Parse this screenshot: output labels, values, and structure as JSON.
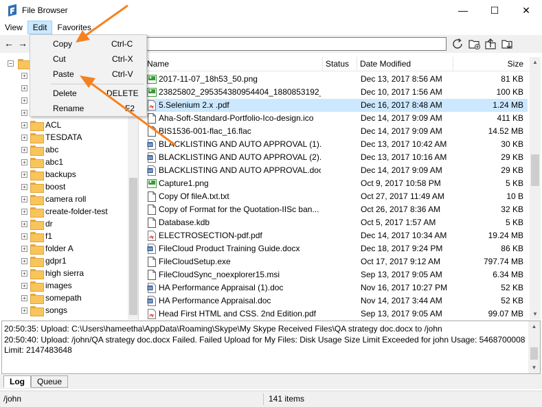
{
  "window": {
    "title": "File Browser",
    "controls": {
      "minimize": "—",
      "maximize": "☐",
      "close": "✕"
    }
  },
  "menubar": {
    "items": [
      "View",
      "Edit",
      "Favorites"
    ],
    "active": "Edit"
  },
  "toolbar": {
    "back": "←",
    "forward": "→",
    "path": ""
  },
  "edit_menu": {
    "items": [
      {
        "label": "Copy",
        "shortcut": "Ctrl-C"
      },
      {
        "label": "Cut",
        "shortcut": "Ctrl-X"
      },
      {
        "label": "Paste",
        "shortcut": "Ctrl-V"
      },
      {
        "label": "Delete",
        "shortcut": "DELETE"
      },
      {
        "label": "Rename",
        "shortcut": "F2"
      }
    ]
  },
  "tree": {
    "folders": [
      "ACL",
      "TESDATA",
      "abc",
      "abc1",
      "backups",
      "boost",
      "camera roll",
      "create-folder-test",
      "dr",
      "f1",
      "folder A",
      "gdpr1",
      "high sierra",
      "images",
      "somepath",
      "songs"
    ],
    "expander": "+"
  },
  "file_list": {
    "columns": {
      "name": "Name",
      "status": "Status",
      "modified": "Date Modified",
      "size": "Size"
    },
    "rows": [
      {
        "name": "2017-11-07_18h53_50.png",
        "status": "",
        "modified": "Dec 13, 2017 8:56 AM",
        "size": "81 KB",
        "type": "image"
      },
      {
        "name": "23825802_295354380954404_1880853192_o....",
        "status": "",
        "modified": "Dec 10, 2017 1:56 AM",
        "size": "100 KB",
        "type": "image"
      },
      {
        "name": "5.Selenium 2.x .pdf",
        "status": "",
        "modified": "Dec 16, 2017 8:48 AM",
        "size": "1.24 MB",
        "type": "pdf"
      },
      {
        "name": "Aha-Soft-Standard-Portfolio-Ico-design.ico",
        "status": "",
        "modified": "Dec 14, 2017 9:09 AM",
        "size": "411 KB",
        "type": "generic"
      },
      {
        "name": "BIS1536-001-flac_16.flac",
        "status": "",
        "modified": "Dec 14, 2017 9:09 AM",
        "size": "14.52 MB",
        "type": "generic"
      },
      {
        "name": "BLACKLISTING AND AUTO APPROVAL (1)....",
        "status": "",
        "modified": "Dec 13, 2017 10:42 AM",
        "size": "30 KB",
        "type": "word"
      },
      {
        "name": "BLACKLISTING AND AUTO APPROVAL (2)....",
        "status": "",
        "modified": "Dec 13, 2017 10:16 AM",
        "size": "29 KB",
        "type": "word"
      },
      {
        "name": "BLACKLISTING AND AUTO APPROVAL.docx",
        "status": "",
        "modified": "Dec 14, 2017 9:09 AM",
        "size": "29 KB",
        "type": "word"
      },
      {
        "name": "Capture1.png",
        "status": "",
        "modified": "Oct 9, 2017 10:58 PM",
        "size": "5 KB",
        "type": "image"
      },
      {
        "name": "Copy Of fileA.txt.txt",
        "status": "",
        "modified": "Oct 27, 2017 11:49 AM",
        "size": "10 B",
        "type": "generic"
      },
      {
        "name": "Copy of Format for the Quotation-IISc ban...",
        "status": "",
        "modified": "Oct 26, 2017 8:36 AM",
        "size": "32 KB",
        "type": "generic"
      },
      {
        "name": "Database.kdb",
        "status": "",
        "modified": "Oct 5, 2017 1:57 AM",
        "size": "5 KB",
        "type": "generic"
      },
      {
        "name": "ELECTROSECTION-pdf.pdf",
        "status": "",
        "modified": "Dec 14, 2017 10:34 AM",
        "size": "19.24 MB",
        "type": "pdf"
      },
      {
        "name": "FileCloud Product Training Guide.docx",
        "status": "",
        "modified": "Dec 18, 2017 9:24 PM",
        "size": "86 KB",
        "type": "word"
      },
      {
        "name": "FileCloudSetup.exe",
        "status": "",
        "modified": "Oct 17, 2017 9:12 AM",
        "size": "797.74 MB",
        "type": "generic"
      },
      {
        "name": "FileCloudSync_noexplorer15.msi",
        "status": "",
        "modified": "Sep 13, 2017 9:05 AM",
        "size": "6.34 MB",
        "type": "generic"
      },
      {
        "name": "HA Performance Appraisal (1).doc",
        "status": "",
        "modified": "Nov 16, 2017 10:27 PM",
        "size": "52 KB",
        "type": "word"
      },
      {
        "name": "HA Performance Appraisal.doc",
        "status": "",
        "modified": "Nov 14, 2017 3:44 AM",
        "size": "52 KB",
        "type": "word"
      },
      {
        "name": "Head First HTML and CSS. 2nd Edition.pdf",
        "status": "",
        "modified": "Sep 13, 2017 9:05 AM",
        "size": "99.07 MB",
        "type": "pdf"
      }
    ],
    "selected_row": "5.Selenium 2.x .pdf"
  },
  "log": {
    "lines": [
      "20:50:35: Upload: C:\\Users\\hameetha\\AppData\\Roaming\\Skype\\My Skype Received Files\\QA strategy doc.docx to /john",
      "20:50:40: Upload: /john/QA strategy doc.docx Failed. Failed Upload for My Files: Disk Usage Size Limit Exceeded for john Usage: 5468700008",
      "Limit: 2147483648"
    ]
  },
  "tabs": {
    "items": [
      "Log",
      "Queue"
    ],
    "active": "Log"
  },
  "status": {
    "path": "/john",
    "count": "141 items"
  },
  "colors": {
    "accent": "#f58220",
    "selection": "#cce8ff",
    "pdf": "#d83b2a",
    "word": "#2b5797",
    "image": "#3a9a3a"
  },
  "icons": {
    "app": "filecloud-logo-icon",
    "refresh": "refresh-icon",
    "new_folder": "new-folder-icon",
    "upload": "upload-icon",
    "download": "download-icon"
  }
}
